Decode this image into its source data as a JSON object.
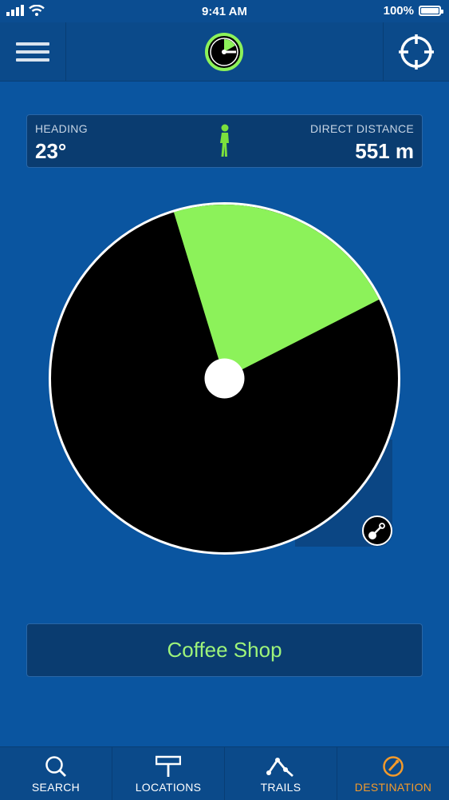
{
  "status": {
    "time": "9:41 AM",
    "battery": "100%"
  },
  "header": {
    "menu_icon": "hamburger-icon",
    "logo_icon": "app-logo-icon",
    "locate_icon": "crosshair-icon"
  },
  "info": {
    "heading_label": "HEADING",
    "heading_value": "23°",
    "distance_label": "DIRECT DISTANCE",
    "distance_value": "551 m",
    "mode_icon": "walking-person-icon"
  },
  "dial": {
    "heading_degrees": 23,
    "sector_color": "#8cf25a",
    "dial_color": "#000000",
    "rim_color": "#ffffff"
  },
  "destination": {
    "label": "Coffee Shop"
  },
  "tabs": [
    {
      "label": "SEARCH",
      "icon": "search-icon",
      "active": false
    },
    {
      "label": "LOCATIONS",
      "icon": "signpost-icon",
      "active": false
    },
    {
      "label": "TRAILS",
      "icon": "trail-route-icon",
      "active": false
    },
    {
      "label": "DESTINATION",
      "icon": "compass-needle-icon",
      "active": true
    }
  ],
  "colors": {
    "background": "#0a55a0",
    "accent_green": "#8cf25a",
    "active_tab": "#f39a2b"
  }
}
